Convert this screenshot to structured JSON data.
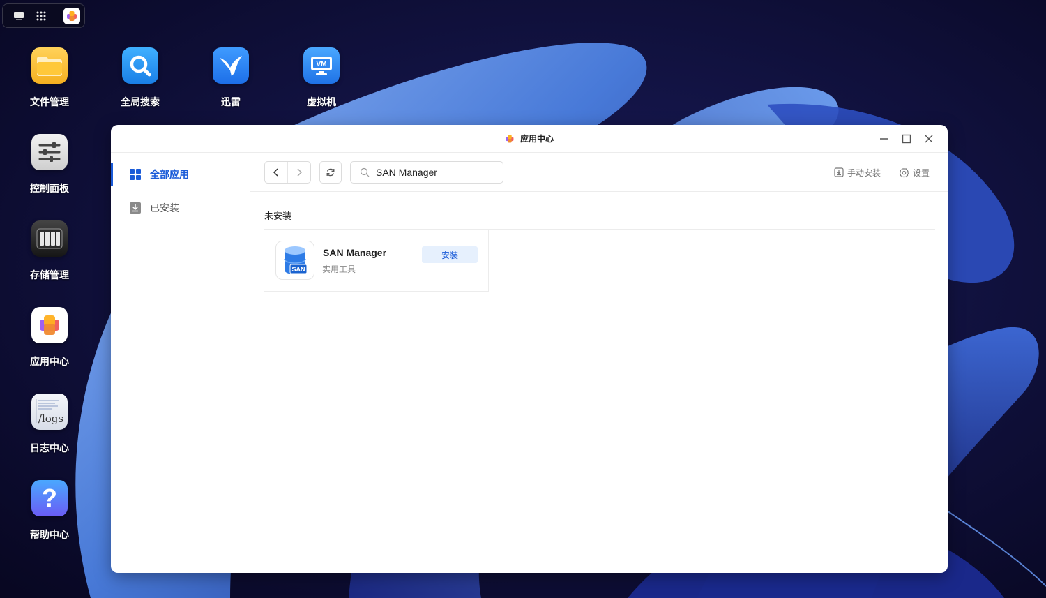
{
  "desktop": {
    "icons": [
      {
        "label": "文件管理",
        "icon": "folder-icon"
      },
      {
        "label": "全局搜索",
        "icon": "search-icon"
      },
      {
        "label": "迅雷",
        "icon": "thunder-bird-icon"
      },
      {
        "label": "虚拟机",
        "icon": "vm-monitor-icon"
      },
      {
        "label": "控制面板",
        "icon": "sliders-icon"
      },
      {
        "label": "存储管理",
        "icon": "drive-bays-icon"
      },
      {
        "label": "应用中心",
        "icon": "app-center-icon"
      },
      {
        "label": "日志中心",
        "icon": "logs-icon",
        "glyph": "/logs"
      },
      {
        "label": "帮助中心",
        "icon": "help-question-icon",
        "glyph": "?"
      }
    ]
  },
  "taskbar": {
    "items": [
      "show-desktop-icon",
      "app-grid-icon",
      "app-center-icon"
    ]
  },
  "window": {
    "title": "应用中心",
    "controls": [
      "minimize-icon",
      "maximize-icon",
      "close-icon"
    ],
    "sidebar": {
      "items": [
        {
          "label": "全部应用",
          "icon": "grid-icon",
          "active": true
        },
        {
          "label": "已安装",
          "icon": "download-tray-icon",
          "active": false
        }
      ]
    },
    "toolbar": {
      "search_value": "SAN Manager",
      "manual_install_label": "手动安装",
      "settings_label": "设置"
    },
    "section": {
      "title": "未安装"
    },
    "apps": [
      {
        "name": "SAN Manager",
        "category": "实用工具",
        "button": "安装",
        "icon_badge": "SAN"
      }
    ]
  },
  "colors": {
    "accent": "#1a5bd8",
    "install_bg": "#e6f0fd",
    "desktop_bg": "#0b0a30"
  }
}
